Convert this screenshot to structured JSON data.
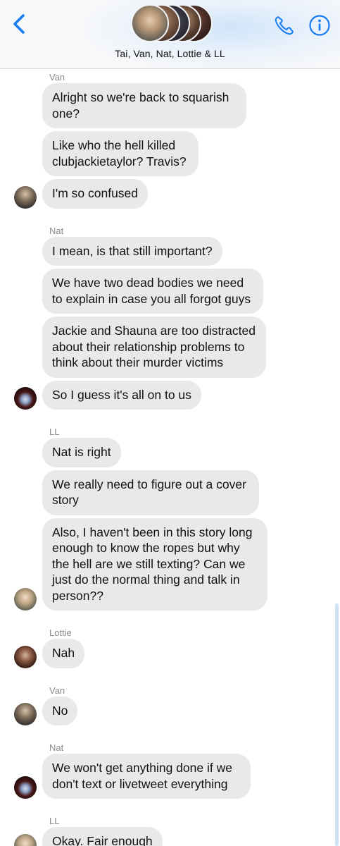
{
  "header": {
    "title": "Tai, Van, Nat, Lottie & LL",
    "accent_color": "#1a7cf4",
    "icons": [
      "chevron-left-icon",
      "phone-icon",
      "info-icon"
    ]
  },
  "messages": [
    {
      "sender": "Van",
      "avatar": "van",
      "bubbles": [
        "Alright so we're back to squarish one?",
        "Like who the hell killed clubjackietaylor? Travis?",
        "I'm so confused"
      ]
    },
    {
      "sender": "Nat",
      "avatar": "nat",
      "bubbles": [
        "I mean, is that still important?",
        "We have two dead bodies we need to explain in case you all forgot guys",
        "Jackie and Shauna are too distracted about their relationship problems to think about their murder victims",
        "So I guess it's all on to us"
      ]
    },
    {
      "sender": "LL",
      "avatar": "ll",
      "bubbles": [
        "Nat is right",
        "We really need to figure out a cover story",
        "Also, I haven't been in this story long enough to know the ropes but why the hell are we still texting? Can we just do the normal thing and talk in person??"
      ]
    },
    {
      "sender": "Lottie",
      "avatar": "lottie",
      "bubbles": [
        "Nah"
      ]
    },
    {
      "sender": "Van",
      "avatar": "van",
      "bubbles": [
        "No"
      ]
    },
    {
      "sender": "Nat",
      "avatar": "nat",
      "bubbles": [
        "We won't get anything done if we don't text or livetweet  everything"
      ]
    },
    {
      "sender": "LL",
      "avatar": "ll",
      "bubbles": [
        "Okay. Fair enough"
      ]
    }
  ]
}
